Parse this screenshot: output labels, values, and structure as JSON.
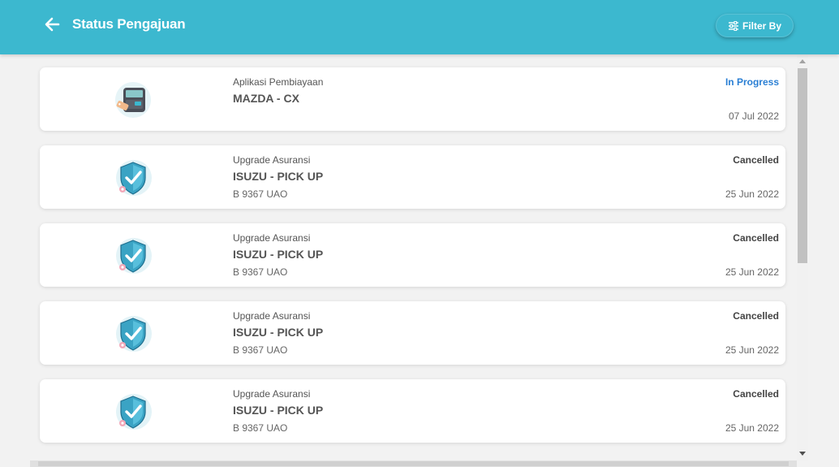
{
  "header": {
    "title": "Status Pengajuan",
    "filter_label": "Filter By",
    "back_icon": "arrow-left-icon",
    "filter_icon": "sliders-icon",
    "color": "#3cb8cf"
  },
  "items": [
    {
      "icon": "cash-register-icon",
      "type": "Aplikasi Pembiayaan",
      "name": "MAZDA - CX",
      "plate": "",
      "status": "In Progress",
      "date": "07 Jul 2022"
    },
    {
      "icon": "shield-check-icon",
      "type": "Upgrade Asuransi",
      "name": "ISUZU - PICK UP",
      "plate": "B 9367 UAO",
      "status": "Cancelled",
      "date": "25 Jun 2022"
    },
    {
      "icon": "shield-check-icon",
      "type": "Upgrade Asuransi",
      "name": "ISUZU - PICK UP",
      "plate": "B 9367 UAO",
      "status": "Cancelled",
      "date": "25 Jun 2022"
    },
    {
      "icon": "shield-check-icon",
      "type": "Upgrade Asuransi",
      "name": "ISUZU - PICK UP",
      "plate": "B 9367 UAO",
      "status": "Cancelled",
      "date": "25 Jun 2022"
    },
    {
      "icon": "shield-check-icon",
      "type": "Upgrade Asuransi",
      "name": "ISUZU - PICK UP",
      "plate": "B 9367 UAO",
      "status": "Cancelled",
      "date": "25 Jun 2022"
    }
  ],
  "colors": {
    "status_in_progress": "#2a7fd4",
    "status_cancelled": "#444444"
  }
}
